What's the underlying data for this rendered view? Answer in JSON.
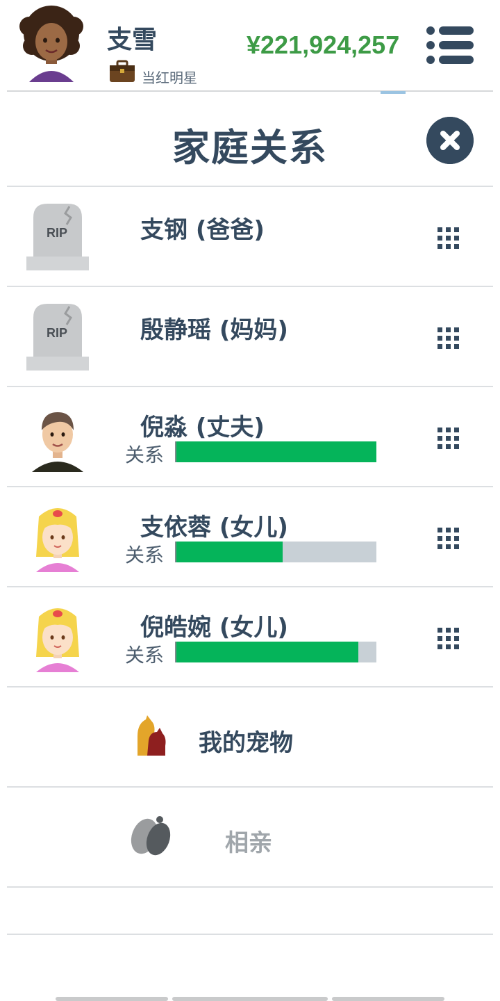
{
  "player": {
    "name": "支雪",
    "job_title": "当红明星",
    "money": "¥221,924,257"
  },
  "panel": {
    "title": "家庭关系"
  },
  "relationship_label": "关系",
  "members": [
    {
      "name": "支钢 (爸爸)",
      "status": "deceased",
      "tombstone_text": "RIP"
    },
    {
      "name": "殷静瑶 (妈妈)",
      "status": "deceased",
      "tombstone_text": "RIP"
    },
    {
      "name": "倪淼 (丈夫)",
      "status": "alive",
      "relationship": 1.0
    },
    {
      "name": "支依蓉 (女儿)",
      "status": "alive",
      "relationship": 0.53
    },
    {
      "name": "倪皓婉 (女儿)",
      "status": "alive",
      "relationship": 0.91
    }
  ],
  "extras": {
    "pets_label": "我的宠物",
    "dating_label": "相亲"
  },
  "colors": {
    "primary": "#34495e",
    "money": "#3d9b46",
    "bar_fill": "#05b45a",
    "bar_track": "#c8d0d6",
    "disabled_text": "#a0a6ab"
  },
  "icons": {
    "menu": "list-menu-icon",
    "close": "close-icon",
    "row_action": "grid-dots-icon",
    "job": "briefcase-icon",
    "pets": "pets-icon",
    "dating": "dating-icon"
  }
}
